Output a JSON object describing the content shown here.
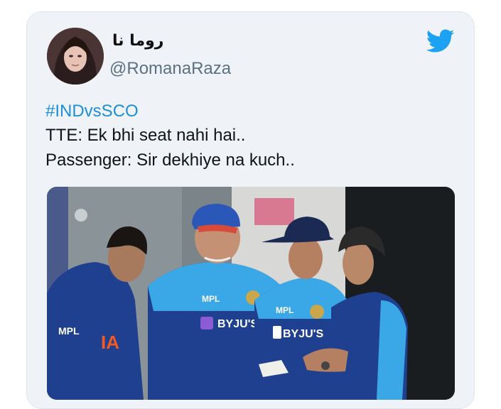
{
  "tweet": {
    "display_name": "روما نا",
    "handle": "@RomanaRaza",
    "hashtag": "#INDvsSCO",
    "lines": [
      "TTE: Ek bhi seat nahi hai..",
      "Passenger: Sir dekhiye na kuch.."
    ]
  },
  "media": {
    "logos": {
      "mpl": "MPL",
      "byjus": "BYJU'S",
      "india": "IA"
    }
  },
  "icons": {
    "brand": "twitter-bird-icon",
    "avatar": "avatar"
  },
  "colors": {
    "card_bg": "#eff3f7",
    "accent": "#1d8fe0",
    "twitter_blue": "#1da1f2",
    "jersey": "#1f3f8f"
  }
}
